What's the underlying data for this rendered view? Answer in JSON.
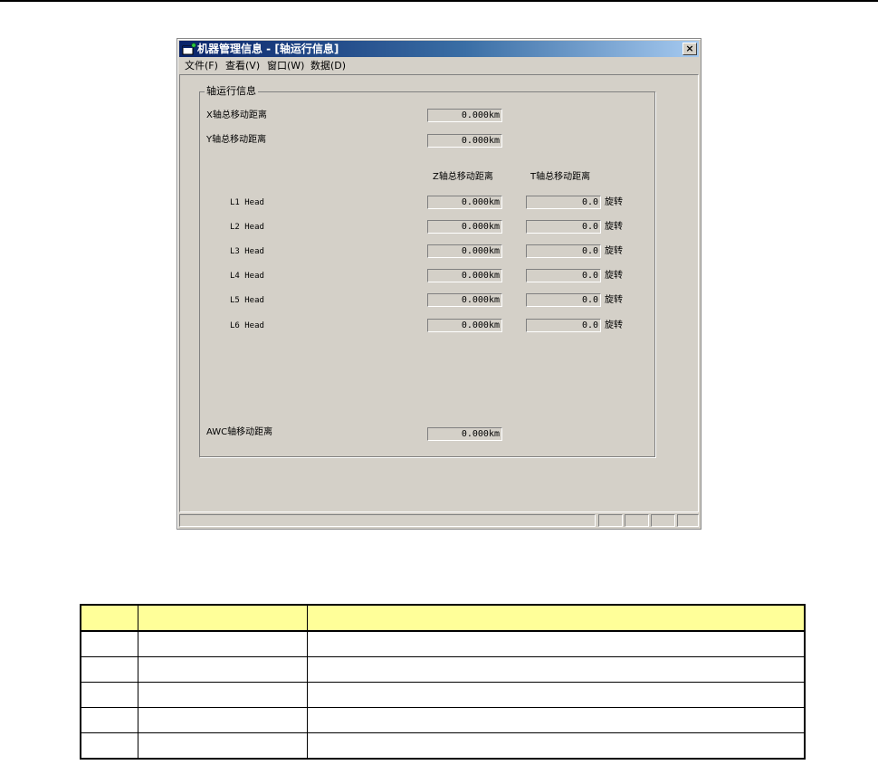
{
  "window": {
    "title": "机器管理信息 - [轴运行信息]",
    "close_label": "×",
    "menu": [
      "文件(F)",
      "查看(V)",
      "窗口(W)",
      "数据(D)"
    ]
  },
  "group": {
    "label": "轴运行信息",
    "x_label": "X轴总移动距离",
    "x_value": "0.000km",
    "y_label": "Y轴总移动距离",
    "y_value": "0.000km",
    "col_z": "Z轴总移动距离",
    "col_t": "T轴总移动距离",
    "heads": [
      {
        "name": "L1 Head",
        "z": "0.000km",
        "t": "0.0",
        "unit": "旋转"
      },
      {
        "name": "L2 Head",
        "z": "0.000km",
        "t": "0.0",
        "unit": "旋转"
      },
      {
        "name": "L3 Head",
        "z": "0.000km",
        "t": "0.0",
        "unit": "旋转"
      },
      {
        "name": "L4 Head",
        "z": "0.000km",
        "t": "0.0",
        "unit": "旋转"
      },
      {
        "name": "L5 Head",
        "z": "0.000km",
        "t": "0.0",
        "unit": "旋转"
      },
      {
        "name": "L6 Head",
        "z": "0.000km",
        "t": "0.0",
        "unit": "旋转"
      }
    ],
    "awc_label": "AWC轴移动距离",
    "awc_value": "0.000km"
  },
  "colors": {
    "window_face": "#d4d0c8",
    "title_dark": "#0a246a",
    "title_light": "#a6caf0",
    "table_header": "#ffff99"
  }
}
